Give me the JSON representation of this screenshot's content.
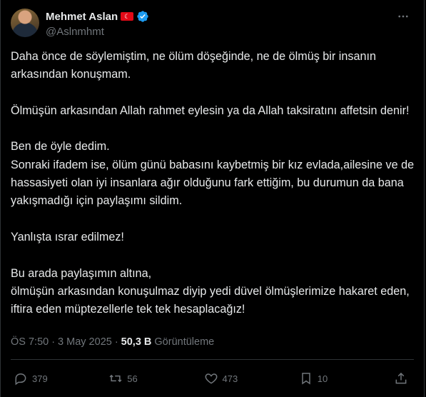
{
  "author": {
    "name": "Mehmet Aslan",
    "flag_emoji": "🇹🇷",
    "handle": "@Aslnmhmt",
    "verified": true
  },
  "post": {
    "paragraphs": [
      "Daha önce de söylemiştim, ne ölüm döşeğinde, ne de ölmüş bir insanın arkasından konuşmam.",
      "Ölmüşün arkasından Allah rahmet eylesin ya da Allah taksiratını affetsin denir!",
      "Ben de öyle dedim.\nSonraki ifadem ise, ölüm günü babasını kaybetmiş bir kız evlada,ailesine ve de hassasiyeti olan iyi insanlara ağır olduğunu fark ettiğim, bu durumun da bana yakışmadığı için paylaşımı sildim.",
      "Yanlışta ısrar edilmez!",
      "Bu arada paylaşımın altına,\nölmüşün arkasından konuşulmaz diyip yedi düvel ölmüşlerimize hakaret eden, iftira eden müptezellerle tek tek hesaplacağız!"
    ]
  },
  "meta": {
    "time": "ÖS 7:50",
    "separator": "·",
    "date": "3 May 2025",
    "views_count": "50,3 B",
    "views_label": "Görüntüleme"
  },
  "actions": {
    "replies": "379",
    "reposts": "56",
    "likes": "473",
    "bookmarks": "10"
  },
  "icons": {
    "more": "more-dots-icon",
    "reply": "reply-icon",
    "repost": "repost-icon",
    "like": "heart-icon",
    "bookmark": "bookmark-icon",
    "share": "share-icon"
  },
  "colors": {
    "background": "#000000",
    "text": "#e7e9ea",
    "secondary": "#71767b",
    "verified": "#1d9bf0",
    "border": "#2f3336"
  }
}
